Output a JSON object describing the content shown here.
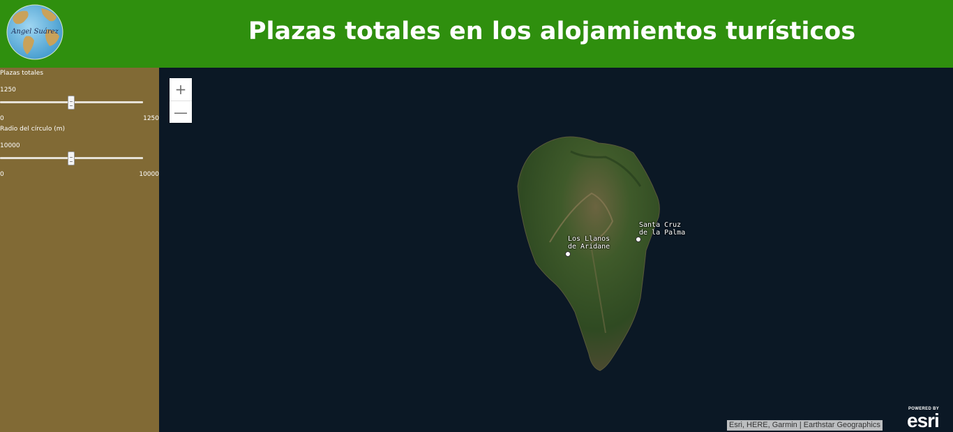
{
  "header": {
    "title": "Plazas totales en los alojamientos turísticos",
    "logo_text": "Angel Suárez"
  },
  "sidebar": {
    "plazas": {
      "label": "Plazas totales",
      "value": "1250",
      "min": "0",
      "max": "1250",
      "level": 0.5
    },
    "radio": {
      "label": "Radio del círculo (m)",
      "value": "10000",
      "min": "0",
      "max": "10000",
      "level": 0.5
    }
  },
  "map": {
    "zoom_in": "+",
    "zoom_out": "—",
    "places": {
      "llanos": [
        "Los Llanos",
        "de Aridane"
      ],
      "santa_cruz": [
        "Santa Cruz",
        "de la Palma"
      ]
    },
    "attribution": "Esri, HERE, Garmin | Earthstar Geographics",
    "esri_powered": "POWERED BY",
    "esri_word": "esri"
  },
  "colors": {
    "header": "#2f8f0e",
    "sidebar": "#816a35",
    "ocean": "#0b1825"
  }
}
